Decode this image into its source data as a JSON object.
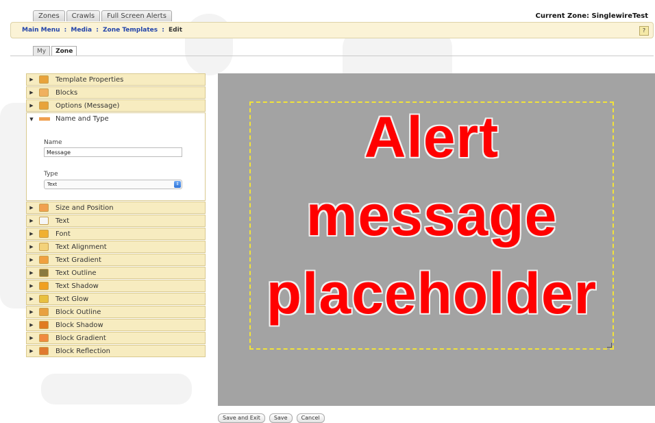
{
  "top_tabs": [
    "Zones",
    "Crawls",
    "Full Screen Alerts"
  ],
  "current_zone": "Current Zone: SinglewireTest",
  "breadcrumb": {
    "items": [
      "Main Menu",
      "Media",
      "Zone Templates"
    ],
    "separator": ":",
    "current": "Edit"
  },
  "help_label": "?",
  "sub_tabs": [
    {
      "label": "My",
      "active": false
    },
    {
      "label": "Zone",
      "active": true
    }
  ],
  "accordion_top": [
    {
      "label": "Template Properties",
      "icon": "pencil-icon",
      "color": "#e8a33b"
    },
    {
      "label": "Blocks",
      "icon": "blocks-icon",
      "color": "#f0b060"
    },
    {
      "label": "Options (Message)",
      "icon": "edit-icon",
      "color": "#e8a33b"
    }
  ],
  "open_section": {
    "label": "Name and Type",
    "name_label": "Name",
    "name_value": "Message",
    "type_label": "Type",
    "type_value": "Text"
  },
  "accordion_bottom": [
    {
      "label": "Size and Position",
      "icon": "move-icon",
      "color": "#f0a050"
    },
    {
      "label": "Text",
      "icon": "document-icon",
      "color": "#f6f6f6"
    },
    {
      "label": "Font",
      "icon": "font-icon",
      "color": "#f0b030"
    },
    {
      "label": "Text Alignment",
      "icon": "align-icon",
      "color": "#f3d27a"
    },
    {
      "label": "Text Gradient",
      "icon": "gradient-icon",
      "color": "#f0a040"
    },
    {
      "label": "Text Outline",
      "icon": "outline-icon",
      "color": "#8a7a40"
    },
    {
      "label": "Text Shadow",
      "icon": "shadow-icon",
      "color": "#f0a020"
    },
    {
      "label": "Text Glow",
      "icon": "glow-icon",
      "color": "#e8c040"
    },
    {
      "label": "Block Outline",
      "icon": "block-outline-icon",
      "color": "#e8a040"
    },
    {
      "label": "Block Shadow",
      "icon": "block-shadow-icon",
      "color": "#e07a20"
    },
    {
      "label": "Block Gradient",
      "icon": "block-gradient-icon",
      "color": "#f08a40"
    },
    {
      "label": "Block Reflection",
      "icon": "block-reflection-icon",
      "color": "#e07a30"
    }
  ],
  "preview": {
    "lines": [
      "Alert",
      "message",
      "placeholder"
    ],
    "text_color": "#ff0000",
    "background": "#a3a3a3",
    "border_color": "#f2e33a"
  },
  "bottom_buttons": [
    "Save and Exit",
    "Save",
    "Cancel"
  ]
}
